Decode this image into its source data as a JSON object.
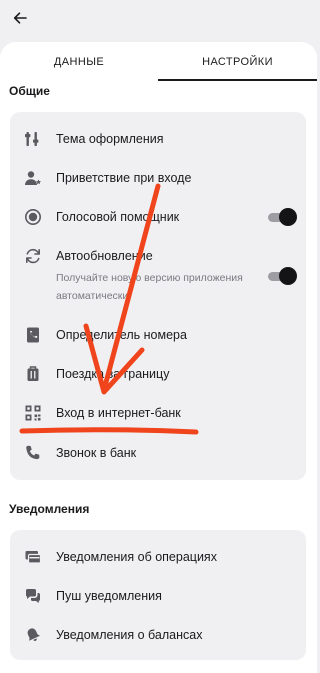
{
  "topbar": {
    "back_icon": "arrow-left-icon"
  },
  "tabs": [
    {
      "label": "ДАННЫЕ",
      "active": false
    },
    {
      "label": "НАСТРОЙКИ",
      "active": true
    }
  ],
  "general": {
    "title": "Общие",
    "items": [
      {
        "icon": "sliders-icon",
        "label": "Тема оформления"
      },
      {
        "icon": "user-star-icon",
        "label": "Приветствие при входе"
      },
      {
        "icon": "voice-assistant-icon",
        "label": "Голосовой помощник",
        "toggle": true
      },
      {
        "icon": "refresh-icon",
        "label": "Автообновление",
        "subtitle": "Получайте новую версию приложения автоматически",
        "toggle": true
      },
      {
        "icon": "phone-book-icon",
        "label": "Определитель номера"
      },
      {
        "icon": "suitcase-icon",
        "label": "Поездка за границу"
      },
      {
        "icon": "qr-code-icon",
        "label": "Вход в интернет-банк"
      },
      {
        "icon": "phone-icon",
        "label": "Звонок в банк"
      }
    ]
  },
  "notifications": {
    "title": "Уведомления",
    "items": [
      {
        "icon": "cards-icon",
        "label": "Уведомления об операциях"
      },
      {
        "icon": "chat-bubbles-icon",
        "label": "Пуш уведомления"
      },
      {
        "icon": "bell-icon",
        "label": "Уведомления о балансах"
      }
    ]
  },
  "colors": {
    "annotation": "#f0441c",
    "text": "#1b1b1d",
    "secondary_text": "#7a7a80",
    "card": "#f0f0f3",
    "icon": "#5a5a60"
  }
}
